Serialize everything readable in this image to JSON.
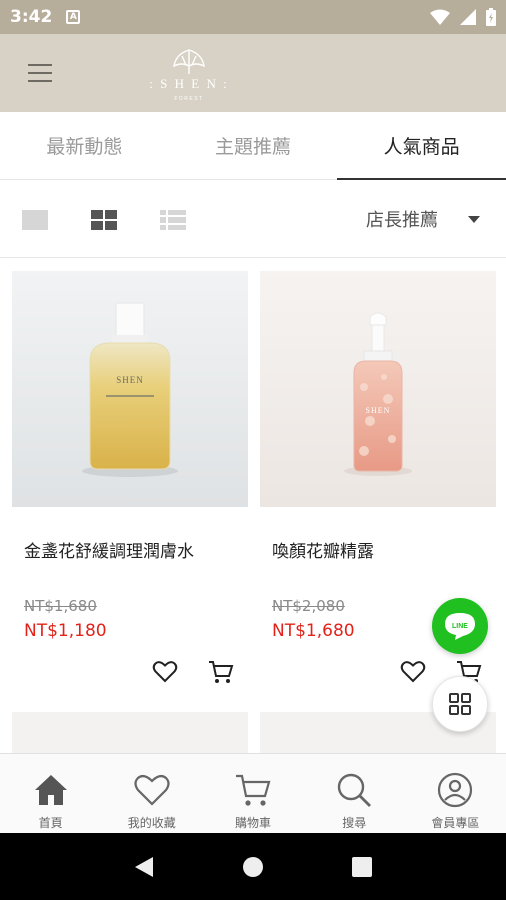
{
  "status_bar": {
    "time": "3:42",
    "notif_letter": "A"
  },
  "header": {
    "logo_text": "SHEN",
    "logo_sub": "FOREST"
  },
  "tabs": [
    {
      "label": "最新動態"
    },
    {
      "label": "主題推薦"
    },
    {
      "label": "人氣商品",
      "active": true
    }
  ],
  "toolbar": {
    "sort_label": "店長推薦",
    "active_view": "grid-2"
  },
  "products": [
    {
      "name": "金盞花舒緩調理潤膚水",
      "original_price": "NT$1,680",
      "sale_price": "NT$1,180",
      "bottle_label": "SHEN",
      "icon_favorite": "heart-icon",
      "icon_cart": "cart-icon"
    },
    {
      "name": "喚顏花瓣精露",
      "original_price": "NT$2,080",
      "sale_price": "NT$1,680",
      "bottle_label": "SHEN",
      "icon_favorite": "heart-icon",
      "icon_cart": "cart-icon"
    }
  ],
  "floating": {
    "line_label": "LINE"
  },
  "bottom_nav": [
    {
      "label": "首頁",
      "icon": "home-icon"
    },
    {
      "label": "我的收藏",
      "icon": "heart-icon"
    },
    {
      "label": "購物車",
      "icon": "cart-icon"
    },
    {
      "label": "搜尋",
      "icon": "search-icon"
    },
    {
      "label": "會員專區",
      "icon": "user-icon"
    }
  ],
  "colors": {
    "status_bar": "#b7ad9b",
    "header": "#d8d2c6",
    "price_sale": "#e2231a",
    "line_green": "#1fc01f"
  }
}
